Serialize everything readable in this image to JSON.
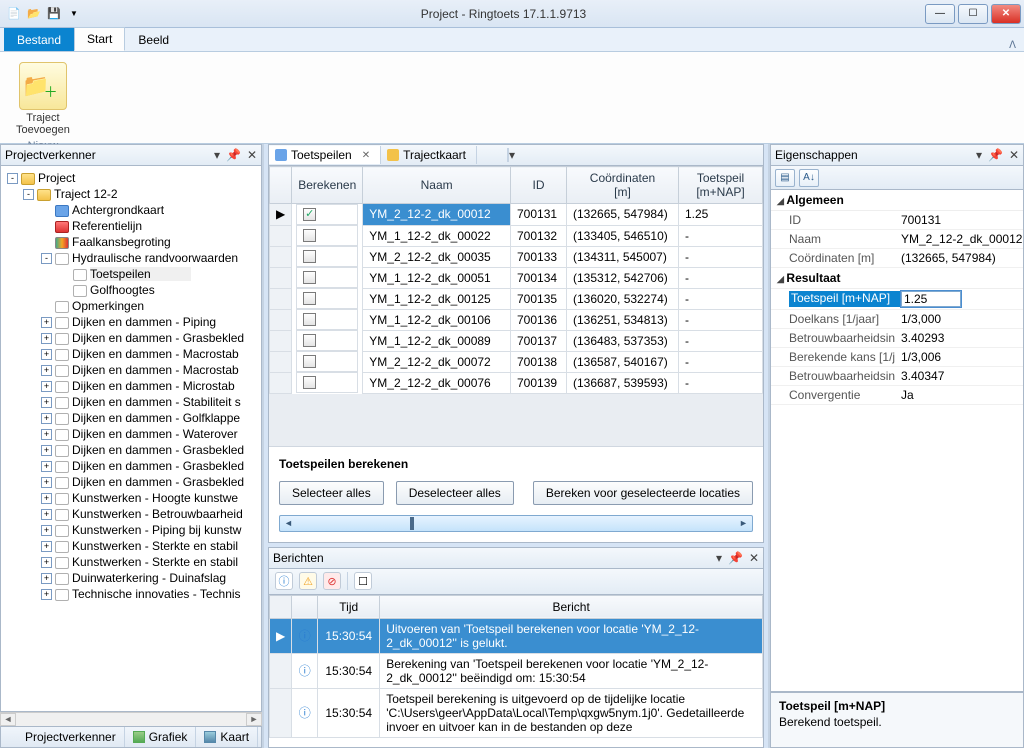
{
  "window": {
    "title": "Project - Ringtoets 17.1.1.9713"
  },
  "ribbon": {
    "tabs": {
      "file": "Bestand",
      "start": "Start",
      "view": "Beeld"
    },
    "traject_btn_l1": "Traject",
    "traject_btn_l2": "Toevoegen",
    "group": "Nieuw"
  },
  "left": {
    "title": "Projectverkenner",
    "root": "Project",
    "traject": "Traject 12-2",
    "nodes2": [
      "Achtergrondkaart",
      "Referentielijn",
      "Faalkansbegroting",
      "Hydraulische randvoorwaarden"
    ],
    "nodes3": [
      "Toetspeilen",
      "Golfhoogtes"
    ],
    "opm": "Opmerkingen",
    "collapsed": [
      "Dijken en dammen - Piping",
      "Dijken en dammen - Grasbekled",
      "Dijken en dammen - Macrostab",
      "Dijken en dammen - Macrostab",
      "Dijken en dammen - Microstab",
      "Dijken en dammen - Stabiliteit s",
      "Dijken en dammen - Golfklappe",
      "Dijken en dammen - Waterover",
      "Dijken en dammen - Grasbekled",
      "Dijken en dammen - Grasbekled",
      "Dijken en dammen - Grasbekled",
      "Kunstwerken - Hoogte kunstwe",
      "Kunstwerken - Betrouwbaarheid",
      "Kunstwerken - Piping bij kunstw",
      "Kunstwerken - Sterkte en stabil",
      "Kunstwerken - Sterkte en stabil",
      "Duinwaterkering - Duinafslag",
      "Technische innovaties - Technis"
    ],
    "tabs": [
      "Projectverkenner",
      "Grafiek",
      "Kaart"
    ]
  },
  "docTabs": {
    "tab1": "Toetspeilen",
    "tab2": "Trajectkaart"
  },
  "grid": {
    "cols": {
      "bereken": "Berekenen",
      "naam": "Naam",
      "id": "ID",
      "coord": "Coördinaten\n[m]",
      "toets": "Toetspeil\n[m+NAP]"
    },
    "rows": [
      {
        "check": true,
        "naam": "YM_2_12-2_dk_00012",
        "id": "700131",
        "coord": "(132665, 547984)",
        "toets": "1.25",
        "sel": true
      },
      {
        "check": false,
        "naam": "YM_1_12-2_dk_00022",
        "id": "700132",
        "coord": "(133405, 546510)",
        "toets": "-"
      },
      {
        "check": false,
        "naam": "YM_2_12-2_dk_00035",
        "id": "700133",
        "coord": "(134311, 545007)",
        "toets": "-"
      },
      {
        "check": false,
        "naam": "YM_1_12-2_dk_00051",
        "id": "700134",
        "coord": "(135312, 542706)",
        "toets": "-"
      },
      {
        "check": false,
        "naam": "YM_1_12-2_dk_00125",
        "id": "700135",
        "coord": "(136020, 532274)",
        "toets": "-"
      },
      {
        "check": false,
        "naam": "YM_1_12-2_dk_00106",
        "id": "700136",
        "coord": "(136251, 534813)",
        "toets": "-"
      },
      {
        "check": false,
        "naam": "YM_1_12-2_dk_00089",
        "id": "700137",
        "coord": "(136483, 537353)",
        "toets": "-"
      },
      {
        "check": false,
        "naam": "YM_2_12-2_dk_00072",
        "id": "700138",
        "coord": "(136587, 540167)",
        "toets": "-"
      },
      {
        "check": false,
        "naam": "YM_2_12-2_dk_00076",
        "id": "700139",
        "coord": "(136687, 539593)",
        "toets": "-"
      }
    ],
    "footer_title": "Toetspeilen berekenen",
    "btn_select_all": "Selecteer alles",
    "btn_deselect_all": "Deselecteer alles",
    "btn_calc": "Bereken voor geselecteerde locaties"
  },
  "berichten": {
    "title": "Berichten",
    "cols": {
      "tijd": "Tijd",
      "bericht": "Bericht"
    },
    "rows": [
      {
        "time": "15:30:54",
        "msg": "Uitvoeren van 'Toetspeil berekenen voor locatie 'YM_2_12-2_dk_00012'' is gelukt.",
        "sel": true
      },
      {
        "time": "15:30:54",
        "msg": "Berekening van 'Toetspeil berekenen voor locatie 'YM_2_12-2_dk_00012'' beëindigd om: 15:30:54"
      },
      {
        "time": "15:30:54",
        "msg": "Toetspeil berekening is uitgevoerd op de tijdelijke locatie 'C:\\Users\\geer\\AppData\\Local\\Temp\\qxgw5nym.1j0'. Gedetailleerde invoer en uitvoer kan in de bestanden op deze "
      }
    ]
  },
  "props": {
    "title": "Eigenschappen",
    "cat1": "Algemeen",
    "p": {
      "id_l": "ID",
      "id_v": "700131",
      "naam_l": "Naam",
      "naam_v": "YM_2_12-2_dk_00012",
      "coord_l": "Coördinaten [m]",
      "coord_v": "(132665, 547984)"
    },
    "cat2": "Resultaat",
    "r": {
      "toets_l": "Toetspeil [m+NAP]",
      "toets_v": "1.25",
      "doelk_l": "Doelkans [1/jaar]",
      "doelk_v": "1/3,000",
      "betr1_l": "Betrouwbaarheidsin",
      "betr1_v": "3.40293",
      "berk_l": "Berekende kans [1/j",
      "berk_v": "1/3,006",
      "betr2_l": "Betrouwbaarheidsin",
      "betr2_v": "3.40347",
      "conv_l": "Convergentie",
      "conv_v": "Ja"
    },
    "help_title": "Toetspeil [m+NAP]",
    "help_text": "Berekend toetspeil."
  }
}
